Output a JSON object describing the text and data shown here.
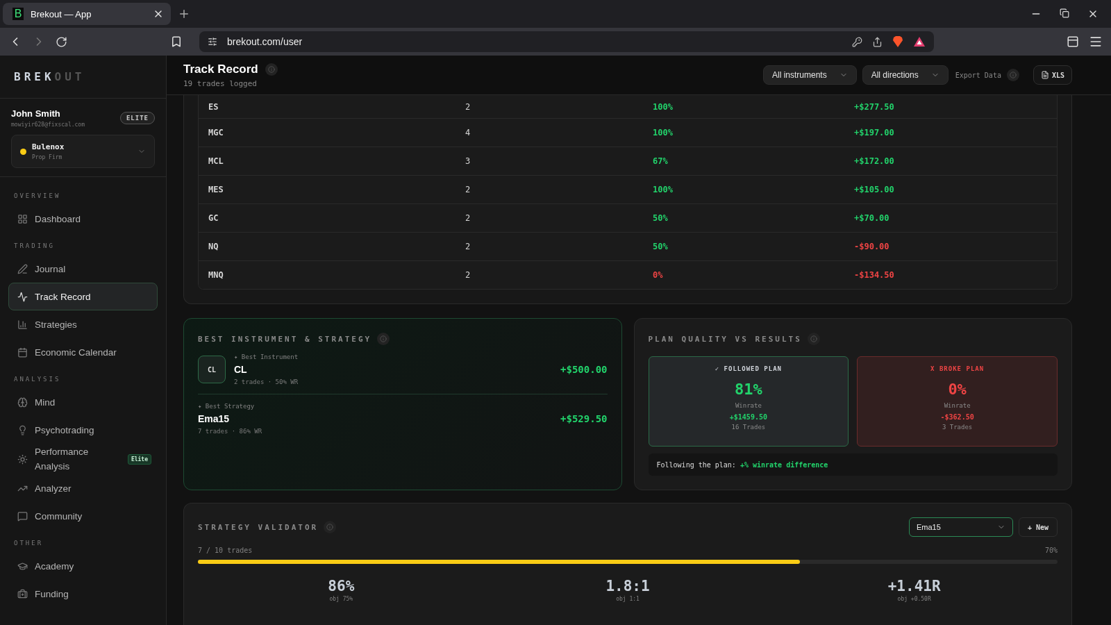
{
  "browser": {
    "tab_title": "Brekout — App",
    "tab_icon_letter": "B",
    "url": "brekout.com/user"
  },
  "sidebar": {
    "logo": {
      "bright": "BREK",
      "dim": "OUT"
    },
    "user": {
      "name": "John Smith",
      "email": "mowiyir628@fixscal.com",
      "plan_badge": "ELITE"
    },
    "account": {
      "name": "Bulenox",
      "type": "Prop Firm",
      "color": "#facc15"
    },
    "sections": [
      {
        "title": "OVERVIEW",
        "items": [
          {
            "label": "Dashboard",
            "selected": false
          }
        ]
      },
      {
        "title": "TRADING",
        "items": [
          {
            "label": "Journal",
            "selected": false
          },
          {
            "label": "Track Record",
            "selected": true
          },
          {
            "label": "Strategies",
            "selected": false
          },
          {
            "label": "Economic Calendar",
            "selected": false
          }
        ]
      },
      {
        "title": "ANALYSIS",
        "items": [
          {
            "label": "Mind",
            "selected": false
          },
          {
            "label": "Psychotrading",
            "selected": false
          },
          {
            "label": "Performance Analysis",
            "selected": false,
            "badge": "Elite"
          },
          {
            "label": "Analyzer",
            "selected": false
          },
          {
            "label": "Community",
            "selected": false
          }
        ]
      },
      {
        "title": "OTHER",
        "items": [
          {
            "label": "Academy",
            "selected": false
          },
          {
            "label": "Funding",
            "selected": false
          }
        ]
      }
    ]
  },
  "header": {
    "title": "Track Record",
    "subtitle": "19 trades logged",
    "filters": [
      "All instruments",
      "All directions"
    ],
    "export_label": "Export Data",
    "export_button": "XLS"
  },
  "table": {
    "rows": [
      {
        "instrument": "ES",
        "trades": "2",
        "winrate": "100%",
        "winrate_positive": true,
        "pnl": "+$277.50",
        "pnl_positive": true
      },
      {
        "instrument": "MGC",
        "trades": "4",
        "winrate": "100%",
        "winrate_positive": true,
        "pnl": "+$197.00",
        "pnl_positive": true
      },
      {
        "instrument": "MCL",
        "trades": "3",
        "winrate": "67%",
        "winrate_positive": true,
        "pnl": "+$172.00",
        "pnl_positive": true
      },
      {
        "instrument": "MES",
        "trades": "2",
        "winrate": "100%",
        "winrate_positive": true,
        "pnl": "+$105.00",
        "pnl_positive": true
      },
      {
        "instrument": "GC",
        "trades": "2",
        "winrate": "50%",
        "winrate_positive": true,
        "pnl": "+$70.00",
        "pnl_positive": true
      },
      {
        "instrument": "NQ",
        "trades": "2",
        "winrate": "50%",
        "winrate_positive": true,
        "pnl": "-$90.00",
        "pnl_positive": false
      },
      {
        "instrument": "MNQ",
        "trades": "2",
        "winrate": "0%",
        "winrate_positive": false,
        "pnl": "-$134.50",
        "pnl_positive": false
      }
    ]
  },
  "best": {
    "title": "BEST INSTRUMENT & STRATEGY",
    "instrument": {
      "label": "✦ Best Instrument",
      "badge": "CL",
      "name": "CL",
      "meta": "2 trades · 50% WR",
      "pnl": "+$500.00"
    },
    "strategy": {
      "label": "✦ Best Strategy",
      "name": "Ema15",
      "meta": "7 trades · 86% WR",
      "pnl": "+$529.50"
    }
  },
  "plan": {
    "title": "PLAN QUALITY VS RESULTS",
    "boxes": [
      {
        "kind": "good",
        "heading": "✓ FOLLOWED PLAN",
        "rate": "81%",
        "rate_label": "Winrate",
        "pnl": "+$1459.50",
        "trades": "16 Trades"
      },
      {
        "kind": "bad",
        "heading": "X BROKE PLAN",
        "rate": "0%",
        "rate_label": "Winrate",
        "pnl": "-$362.50",
        "trades": "3 Trades"
      }
    ],
    "summary": "Following the plan: ",
    "summary_value": "+% winrate difference"
  },
  "validator": {
    "title": "STRATEGY VALIDATOR",
    "strategy": "Ema15",
    "new_button": "+ New",
    "progress_label": "7 / 10 trades",
    "progress_percent": "70%",
    "level": 0.7,
    "metrics": [
      {
        "value": "86%",
        "objective": "obj 75%"
      },
      {
        "value": "1.8:1",
        "objective": "obj 1:1"
      },
      {
        "value": "+1.41R",
        "objective": "obj +0.50R"
      }
    ]
  }
}
